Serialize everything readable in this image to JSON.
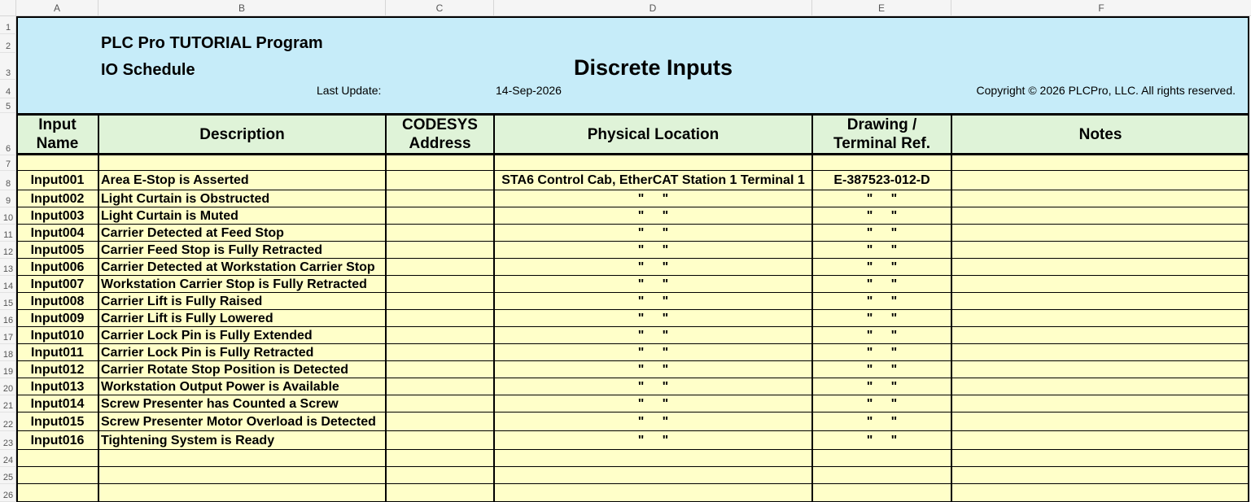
{
  "columns": [
    "A",
    "B",
    "C",
    "D",
    "E",
    "F"
  ],
  "row_numbers": [
    "1",
    "2",
    "3",
    "4",
    "5",
    "6",
    "7",
    "8",
    "9",
    "10",
    "11",
    "12",
    "13",
    "14",
    "15",
    "16",
    "17",
    "18",
    "19",
    "20",
    "21",
    "22",
    "23",
    "24",
    "25",
    "26"
  ],
  "banner": {
    "program_title": "PLC Pro TUTORIAL Program",
    "subtitle": "IO Schedule",
    "sheet_title": "Discrete Inputs",
    "last_update_label": "Last Update:",
    "last_update_value": "14-Sep-2026",
    "copyright": "Copyright © 2026 PLCPro, LLC. All rights reserved."
  },
  "headers": {
    "input_name_line1": "Input",
    "input_name_line2": "Name",
    "description": "Description",
    "codesys_line1": "CODESYS",
    "codesys_line2": "Address",
    "physical_location": "Physical Location",
    "drawing_line1": "Drawing /",
    "drawing_line2": "Terminal Ref.",
    "notes": "Notes"
  },
  "rows": [
    {
      "name": "Input001",
      "description": "Area E-Stop is Asserted",
      "address": "",
      "location": "STA6 Control Cab, EtherCAT Station 1 Terminal 1",
      "drawing": "E-387523-012-D",
      "notes": ""
    },
    {
      "name": "Input002",
      "description": "Light Curtain is Obstructed",
      "address": "",
      "location": "\"     \"",
      "drawing": "\"     \"",
      "notes": ""
    },
    {
      "name": "Input003",
      "description": "Light Curtain is Muted",
      "address": "",
      "location": "\"     \"",
      "drawing": "\"     \"",
      "notes": ""
    },
    {
      "name": "Input004",
      "description": "Carrier Detected at Feed Stop",
      "address": "",
      "location": "\"     \"",
      "drawing": "\"     \"",
      "notes": ""
    },
    {
      "name": "Input005",
      "description": "Carrier Feed Stop is Fully Retracted",
      "address": "",
      "location": "\"     \"",
      "drawing": "\"     \"",
      "notes": ""
    },
    {
      "name": "Input006",
      "description": "Carrier Detected at Workstation Carrier Stop",
      "address": "",
      "location": "\"     \"",
      "drawing": "\"     \"",
      "notes": ""
    },
    {
      "name": "Input007",
      "description": "Workstation Carrier Stop is Fully Retracted",
      "address": "",
      "location": "\"     \"",
      "drawing": "\"     \"",
      "notes": ""
    },
    {
      "name": "Input008",
      "description": "Carrier Lift is Fully Raised",
      "address": "",
      "location": "\"     \"",
      "drawing": "\"     \"",
      "notes": ""
    },
    {
      "name": "Input009",
      "description": "Carrier Lift is Fully Lowered",
      "address": "",
      "location": "\"     \"",
      "drawing": "\"     \"",
      "notes": ""
    },
    {
      "name": "Input010",
      "description": "Carrier Lock Pin is Fully Extended",
      "address": "",
      "location": "\"     \"",
      "drawing": "\"     \"",
      "notes": ""
    },
    {
      "name": "Input011",
      "description": "Carrier Lock Pin is Fully Retracted",
      "address": "",
      "location": "\"     \"",
      "drawing": "\"     \"",
      "notes": ""
    },
    {
      "name": "Input012",
      "description": "Carrier Rotate Stop Position is Detected",
      "address": "",
      "location": "\"     \"",
      "drawing": "\"     \"",
      "notes": ""
    },
    {
      "name": "Input013",
      "description": "Workstation Output Power is Available",
      "address": "",
      "location": "\"     \"",
      "drawing": "\"     \"",
      "notes": ""
    },
    {
      "name": "Input014",
      "description": "Screw Presenter has Counted a Screw",
      "address": "",
      "location": "\"     \"",
      "drawing": "\"     \"",
      "notes": ""
    },
    {
      "name": "Input015",
      "description": "Screw Presenter Motor Overload is Detected",
      "address": "",
      "location": "\"     \"",
      "drawing": "\"     \"",
      "notes": ""
    },
    {
      "name": "Input016",
      "description": "Tightening System is Ready",
      "address": "",
      "location": "\"     \"",
      "drawing": "\"     \"",
      "notes": ""
    }
  ],
  "colors": {
    "banner_fill": "#c6ecf9",
    "header_fill": "#dff3d8",
    "body_fill": "#ffffc9",
    "grid_line": "#000000"
  }
}
